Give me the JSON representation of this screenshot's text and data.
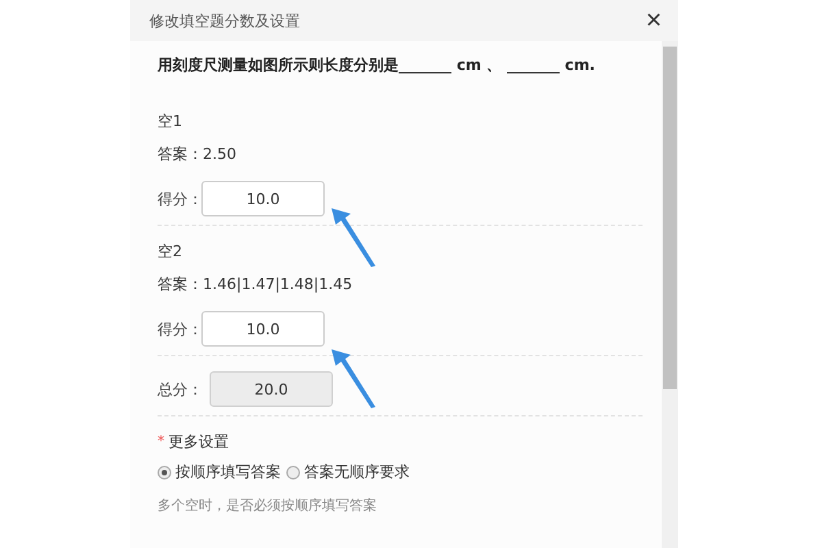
{
  "dialog": {
    "title": "修改填空题分数及设置",
    "close": "×"
  },
  "question": "用刻度尺测量如图所示则长度分别是_______ cm 、 _______ cm.",
  "blanks": [
    {
      "name": "空1",
      "answer": "答案：2.50",
      "score_label": "得分：",
      "score": "10.0"
    },
    {
      "name": "空2",
      "answer": "答案：1.46|1.47|1.48|1.45",
      "score_label": "得分：",
      "score": "10.0"
    }
  ],
  "total": {
    "label": "总分：",
    "value": "20.0"
  },
  "more_settings": {
    "label": "更多设置",
    "required_mark": "*",
    "options": [
      {
        "label": "按顺序填写答案",
        "selected": true
      },
      {
        "label": "答案无顺序要求",
        "selected": false
      }
    ],
    "hint": "多个空时，是否必须按顺序填写答案"
  }
}
